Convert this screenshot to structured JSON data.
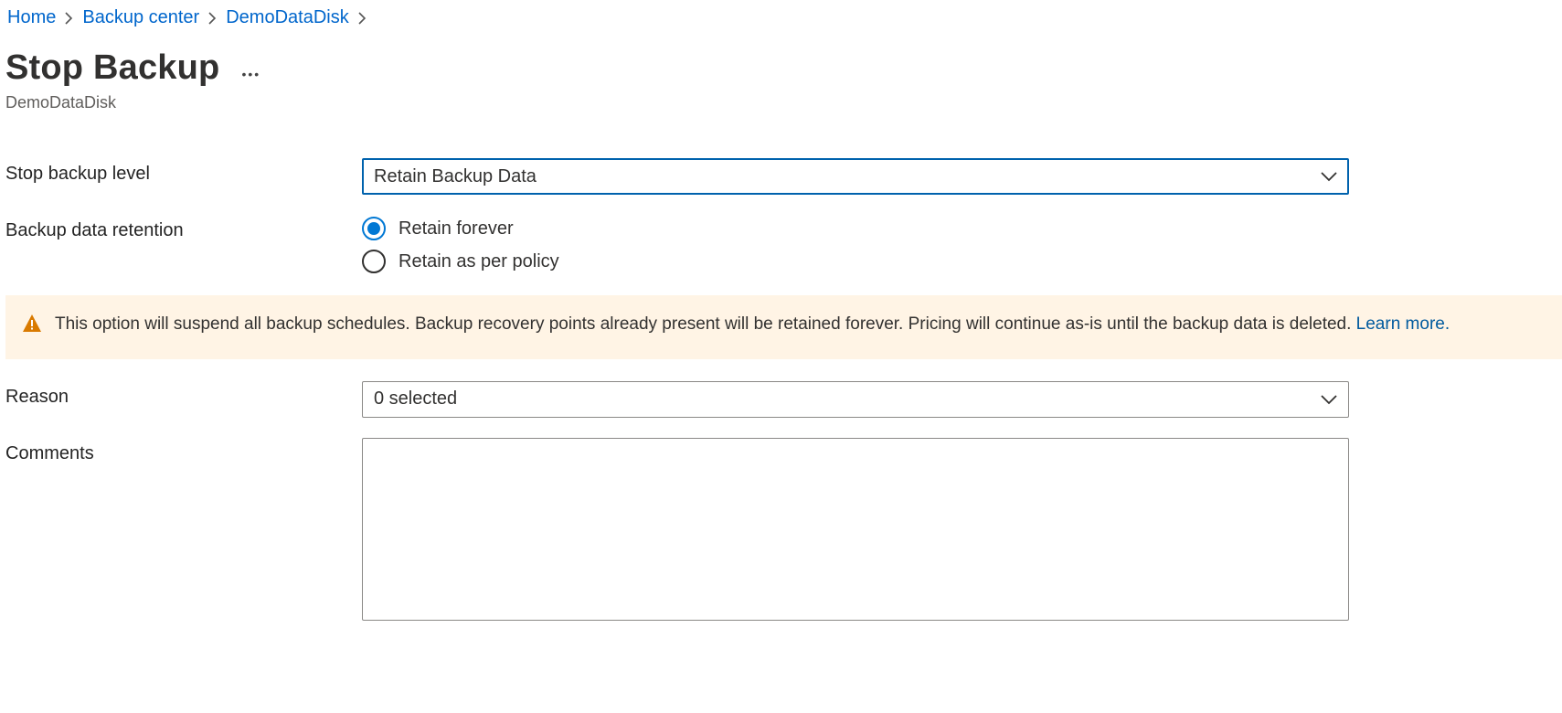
{
  "breadcrumb": {
    "items": [
      {
        "label": "Home"
      },
      {
        "label": "Backup center"
      },
      {
        "label": "DemoDataDisk"
      }
    ]
  },
  "header": {
    "title": "Stop Backup",
    "subtitle": "DemoDataDisk"
  },
  "form": {
    "stop_backup_level": {
      "label": "Stop backup level",
      "value": "Retain Backup Data"
    },
    "retention": {
      "label": "Backup data retention",
      "options": [
        {
          "label": "Retain forever",
          "selected": true
        },
        {
          "label": "Retain as per policy",
          "selected": false
        }
      ]
    },
    "reason": {
      "label": "Reason",
      "value": "0 selected"
    },
    "comments": {
      "label": "Comments",
      "value": ""
    }
  },
  "banner": {
    "text": "This option will suspend all backup schedules. Backup recovery points already present will be retained forever. Pricing will continue as-is until the backup data is deleted. ",
    "link_label": "Learn more."
  }
}
